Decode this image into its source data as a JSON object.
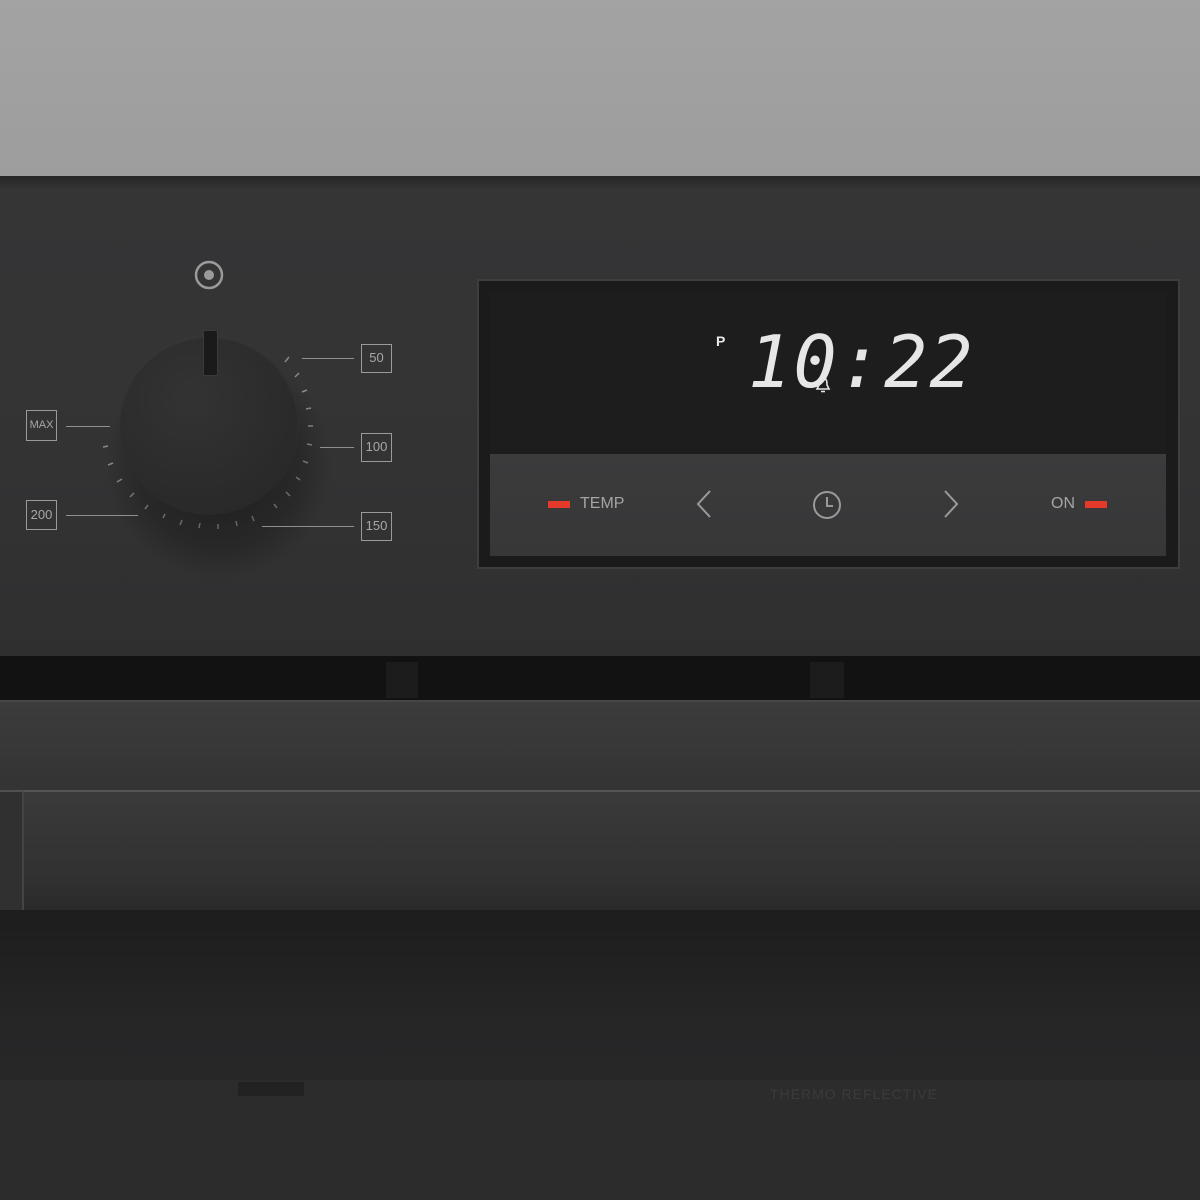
{
  "dial": {
    "labels": [
      "50",
      "100",
      "150",
      "200",
      "MAX"
    ]
  },
  "display": {
    "mode_indicator": "P",
    "time": "10:22",
    "icons": [
      "alarm-bell-icon"
    ]
  },
  "controls": {
    "temp_label": "TEMP",
    "on_label": "ON",
    "icons": [
      "chevron-left-icon",
      "clock-icon",
      "chevron-right-icon"
    ]
  },
  "door": {
    "glass_text": "THERMO REFLECTIVE"
  },
  "colors": {
    "indicator_red": "#e53a2a",
    "panel": "#333334",
    "display_text": "#e6e6e6"
  }
}
